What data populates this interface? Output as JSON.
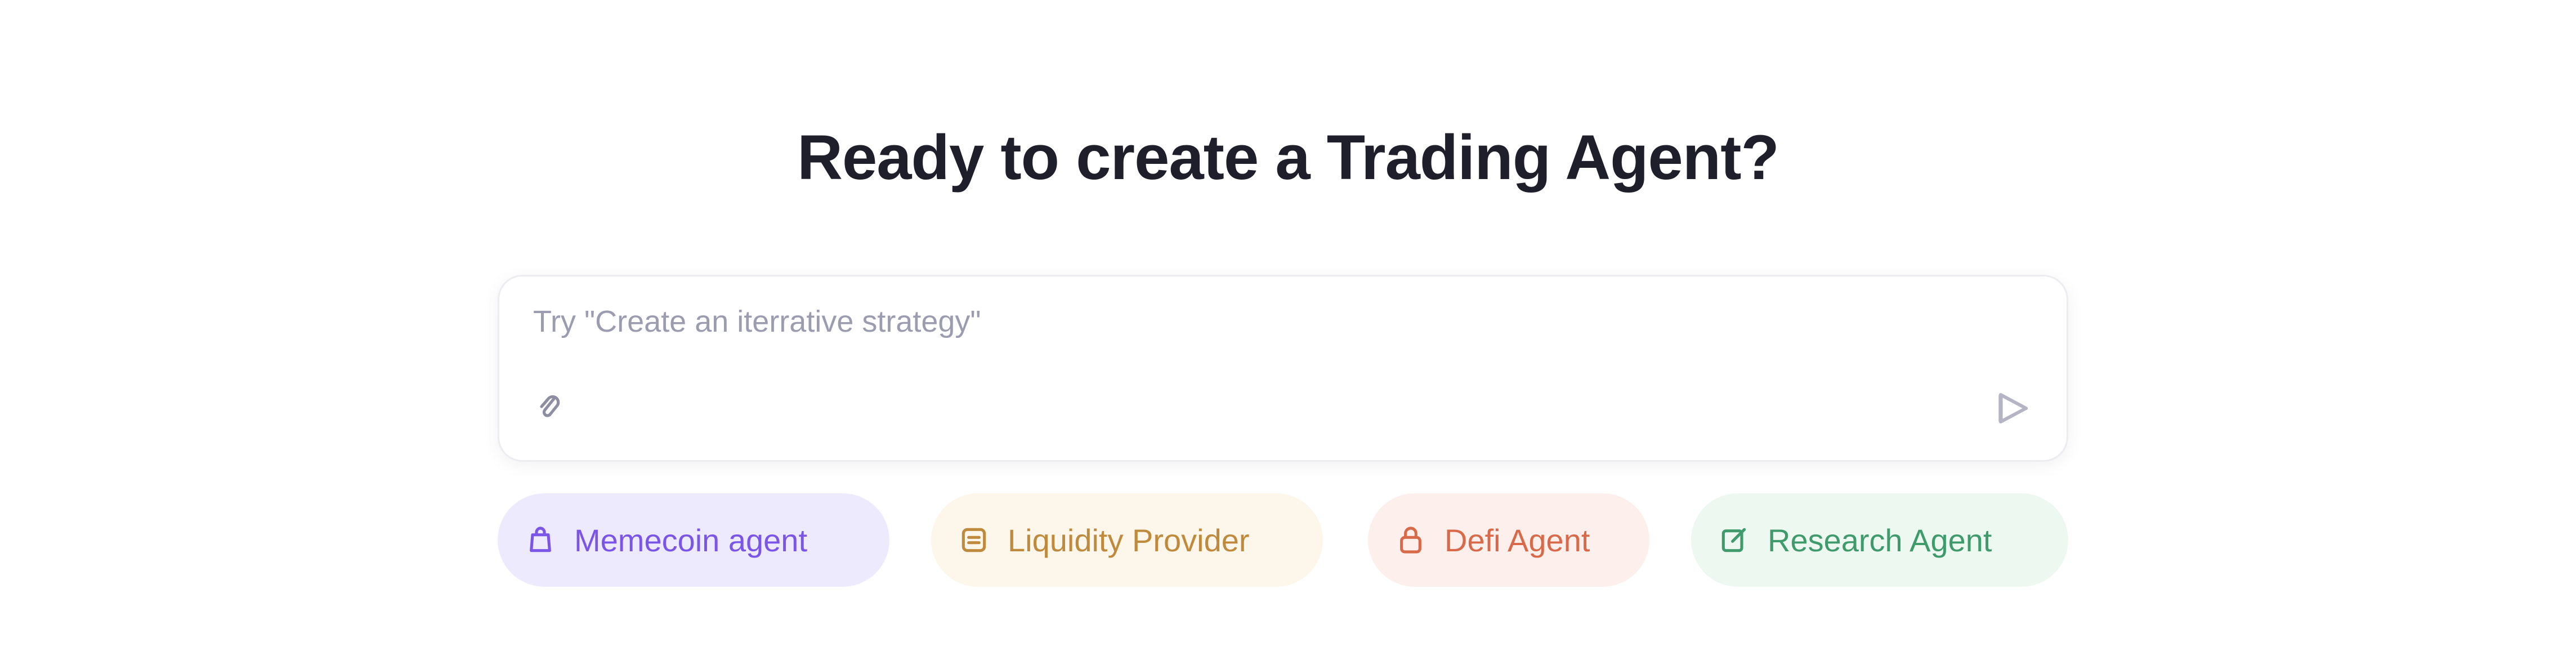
{
  "heading": "Ready to create a Trading Agent?",
  "composer": {
    "value": "",
    "placeholder": "Try \"Create an iterrative strategy\"",
    "attach_icon": "paperclip-icon",
    "send_icon": "send-icon"
  },
  "chips": [
    {
      "label": "Memecoin agent",
      "icon": "bag-icon",
      "color": "#7b55e8",
      "background": "#eeeafe"
    },
    {
      "label": "Liquidity Provider",
      "icon": "pool-icon",
      "color": "#bf8a3c",
      "background": "#fdf6ea"
    },
    {
      "label": "Defi Agent",
      "icon": "lock-icon",
      "color": "#d86a4a",
      "background": "#fdf0ec"
    },
    {
      "label": "Research Agent",
      "icon": "note-edit-icon",
      "color": "#3f9a6c",
      "background": "#edf8f1"
    }
  ]
}
